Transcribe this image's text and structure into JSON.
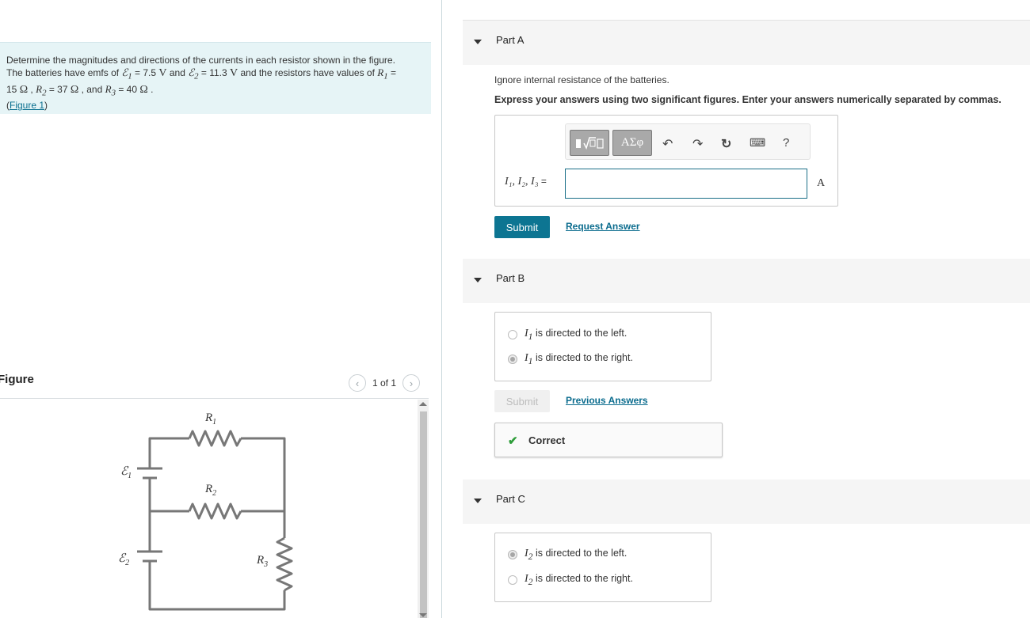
{
  "problem": {
    "text_1": "Determine the magnitudes and directions of the currents in each resistor shown in the figure. The batteries have emfs of ",
    "emf1_symbol": "ℰ",
    "emf1_sub": "1",
    "emf1_value": " = 7.5 ",
    "emf1_unit": "V",
    "text_and": " and ",
    "emf2_symbol": "ℰ",
    "emf2_sub": "2",
    "emf2_value": " = 11.3 ",
    "emf2_unit": "V",
    "text_2": " and the resistors have values of ",
    "r1_symbol": "R",
    "r1_sub": "1",
    "r1_value": " = 15 ",
    "r_unit": "Ω",
    "r2_symbol": "R",
    "r2_sub": "2",
    "r2_value": " = 37 ",
    "text_and2": " , and ",
    "r3_symbol": "R",
    "r3_sub": "3",
    "r3_value": " = 40 ",
    "sep": " , ",
    "end": " .",
    "figure_link_open": "(",
    "figure_link": "Figure 1",
    "figure_link_close": ")"
  },
  "figure": {
    "title": "Figure",
    "counter": "1 of 1",
    "prev_icon": "chevron-left-icon",
    "next_icon": "chevron-right-icon",
    "labels": {
      "e1": "ℰ",
      "e1_sub": "1",
      "e2": "ℰ",
      "e2_sub": "2",
      "r1": "R",
      "r1_sub": "1",
      "r2": "R",
      "r2_sub": "2",
      "r3": "R",
      "r3_sub": "3"
    }
  },
  "part_a": {
    "title": "Part A",
    "instruction_1": "Ignore internal resistance of the batteries.",
    "instruction_2": "Express your answers using two significant figures. Enter your answers numerically separated by commas.",
    "toolbar": {
      "templates": "▮√▢",
      "greek": "ΑΣφ",
      "undo": "↶",
      "redo": "↷",
      "reset": "↻",
      "keyboard": "⌨",
      "help": "?"
    },
    "answer_label": "I₁, I₂, I₃",
    "answer_eq": " =",
    "answer_value": "",
    "unit": "A",
    "submit": "Submit",
    "request_answer": "Request Answer"
  },
  "part_b": {
    "title": "Part B",
    "options": [
      {
        "var": "I",
        "sub": "1",
        "text": " is directed to the left.",
        "checked": false
      },
      {
        "var": "I",
        "sub": "1",
        "text": " is directed to the right.",
        "checked": true
      }
    ],
    "submit": "Submit",
    "previous_answers": "Previous Answers",
    "feedback": "Correct"
  },
  "part_c": {
    "title": "Part C",
    "options": [
      {
        "var": "I",
        "sub": "2",
        "text": " is directed to the left.",
        "checked": true
      },
      {
        "var": "I",
        "sub": "2",
        "text": " is directed to the right.",
        "checked": false
      }
    ]
  }
}
